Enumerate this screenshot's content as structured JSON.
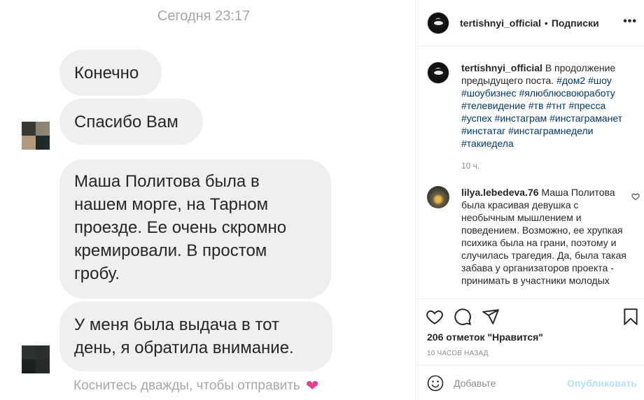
{
  "chat": {
    "time": "Сегодня 23:17",
    "messages": [
      "Конечно",
      "Спасибо Вам",
      "Маша Политова была в нашем морге, на Тарном проезде. Ее очень скромно кремировали. В простом гробу.",
      "У меня была выдача в тот день, я обратила внимание."
    ],
    "hint": "Коснитесь дважды, чтобы отправить",
    "hint_icon": "heart-icon",
    "accent": "#e7408f"
  },
  "post": {
    "header": {
      "username": "tertishnyi_official",
      "separator": "•",
      "follow_label": "Подписки",
      "more_icon": "ellipsis-icon"
    },
    "caption": {
      "username": "tertishnyi_official",
      "text": "В продолжение предыдущего поста.",
      "hashtags": "#дом2 #шоу #шоубизнес #ялюблюсвоюработу #телевидение #тв #тнт #пресса #успех #инстаграм #инстаграманет #инстатаг #инстаграмнедели #такиедела",
      "time": "10 ч."
    },
    "comment": {
      "username": "lilya.lebedeva.76",
      "text": "Маша Политова была красивая девушка с необычным мышлением и поведением. Возможно, ее хрупкая психика была на грани, поэтому и случилась трагедия. Да, была такая забава у организаторов проекта - принимать в участники молодых",
      "like_icon": "heart-outline-icon"
    },
    "likes": "206 отметок \"Нравится\"",
    "posted_ago": "10 ЧАСОВ НАЗАД",
    "add_comment": {
      "placeholder": "Добавьте",
      "publish_label": "Опубликовать",
      "publish_color": "#b2dffc"
    },
    "link_color": "#00376b"
  }
}
